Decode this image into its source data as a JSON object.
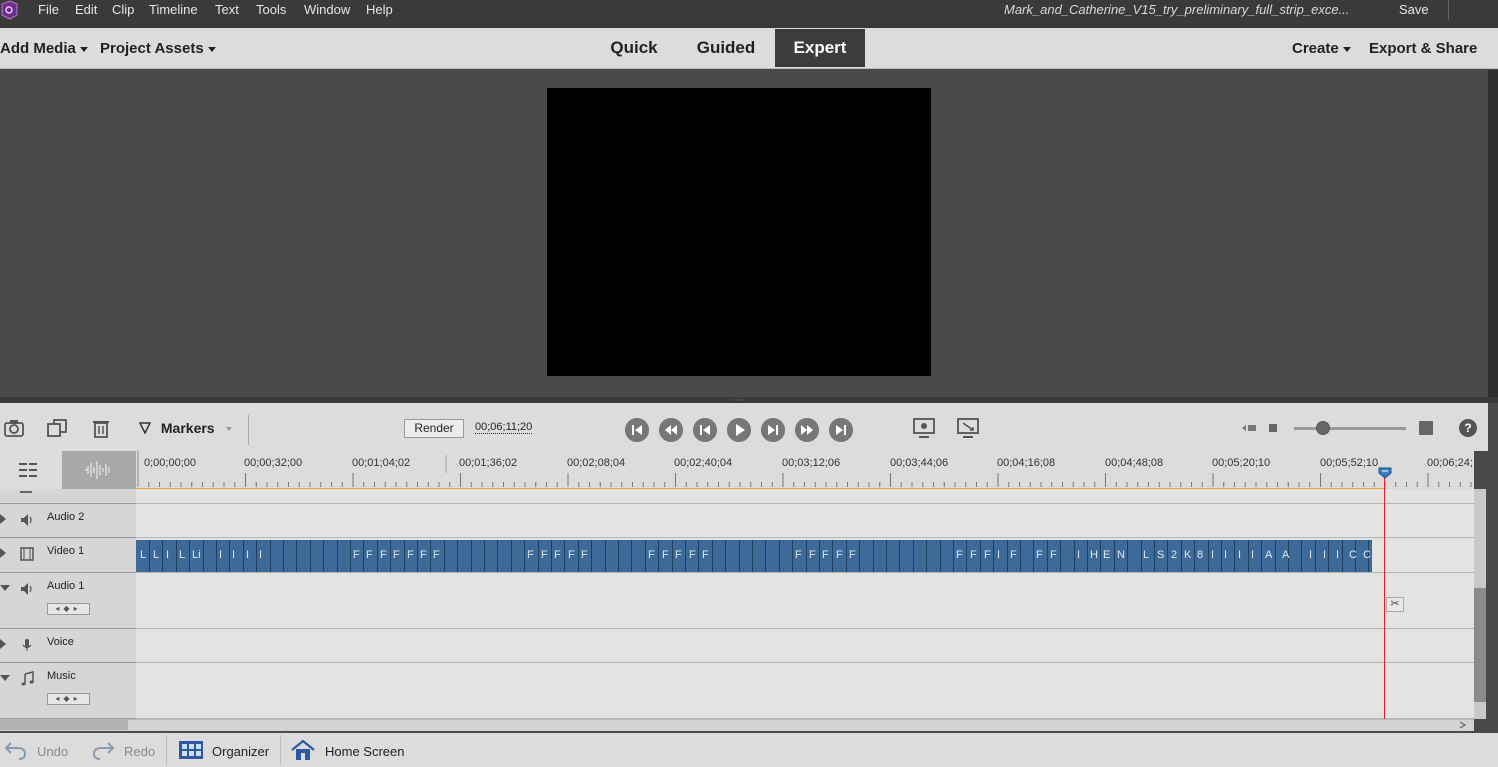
{
  "menubar": {
    "items": [
      "File",
      "Edit",
      "Clip",
      "Timeline",
      "Text",
      "Tools",
      "Window",
      "Help"
    ],
    "document_title": "Mark_and_Catherine_V15_try_preliminary_full_strip_exce...",
    "save_label": "Save"
  },
  "modebar": {
    "add_media": "Add Media",
    "project_assets": "Project Assets",
    "tabs": [
      "Quick",
      "Guided",
      "Expert"
    ],
    "active_tab": "Expert",
    "create": "Create",
    "export_share": "Export & Share"
  },
  "timeline_toolbar": {
    "markers_label": "Markers",
    "render_label": "Render",
    "timecode": "00;06;11;20",
    "help_label": "?"
  },
  "ruler": {
    "labels": [
      "0;00;00;00",
      "00;00;32;00",
      "00;01;04;02",
      "00;01;36;02",
      "00;02;08;04",
      "00;02;40;04",
      "00;03;12;06",
      "00;03;44;06",
      "00;04;16;08",
      "00;04;48;08",
      "00;05;20;10",
      "00;05;52;10",
      "00;06;24;"
    ]
  },
  "tracks": [
    {
      "name": "Audio 2",
      "icon": "speaker-icon",
      "expanded": false
    },
    {
      "name": "Video 1",
      "icon": "film-icon",
      "expanded": false
    },
    {
      "name": "Audio 1",
      "icon": "speaker-icon",
      "expanded": true
    },
    {
      "name": "Voice",
      "icon": "microphone-icon",
      "expanded": false
    },
    {
      "name": "Music",
      "icon": "music-note-icon",
      "expanded": true
    }
  ],
  "clip_labels": [
    "L",
    "L",
    "I",
    "L",
    "Li",
    "I",
    "I",
    "I",
    "I",
    "F",
    "F",
    "F",
    "F",
    "F",
    "F",
    "F",
    "F",
    "F",
    "F",
    "F",
    "F",
    "F",
    "F",
    "F",
    "F",
    "F",
    "F",
    "F",
    "F",
    "F",
    "F",
    "F",
    "F",
    "F",
    "I",
    "F",
    "F",
    "F",
    "I",
    "H",
    "E",
    "N",
    "L",
    "S",
    "2",
    "K",
    "8",
    "I",
    "I",
    "I",
    "I",
    "A",
    "A",
    "I",
    "I",
    "I",
    "C",
    "C",
    "C",
    "I"
  ],
  "bottombar": {
    "undo": "Undo",
    "redo": "Redo",
    "organizer": "Organizer",
    "home_screen": "Home Screen"
  },
  "colors": {
    "clip_blue": "#3d6a99",
    "playhead_red": "#e02020",
    "work_area_orange": "#f0a030"
  }
}
